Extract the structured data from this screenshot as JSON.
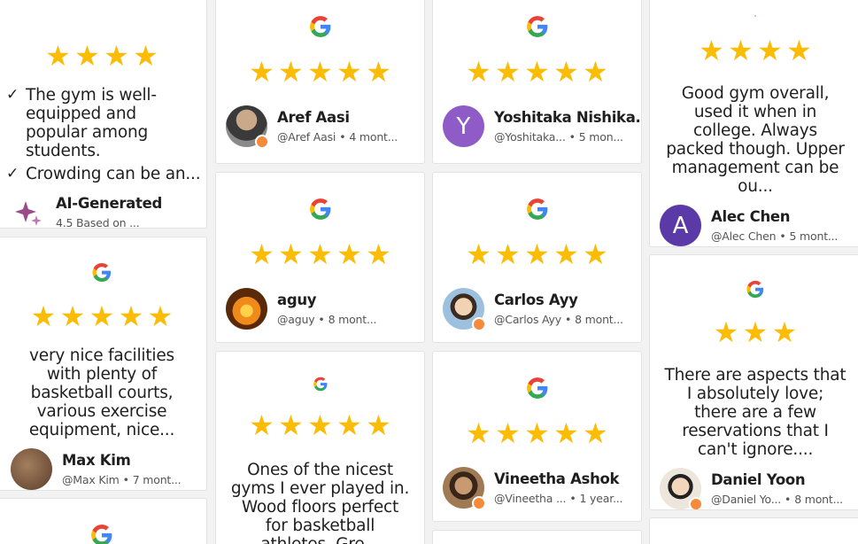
{
  "ai_card": {
    "stars": 4,
    "points": [
      "The gym is well-equipped and popular among students.",
      "Crowding can be an..."
    ],
    "title": "AI-Generated",
    "subtitle": "4.5 Based on ..."
  },
  "reviews": [
    {
      "id": "aref",
      "stars": 5,
      "text": "",
      "name": "Aref Aasi",
      "handle": "@Aref Aasi",
      "time": "4 mont...",
      "avatar_letter": "",
      "avatar_color": "#6b6b6b"
    },
    {
      "id": "yoshitaka",
      "stars": 5,
      "text": "",
      "name": "Yoshitaka Nishika...",
      "handle": "@Yoshitaka...",
      "time": "5 mon...",
      "avatar_letter": "Y",
      "avatar_color": "#8e5bc7"
    },
    {
      "id": "alec",
      "stars": 4,
      "text": "Good gym overall, used it when in college. Always packed though. Upper management can be ou...",
      "name": "Alec Chen",
      "handle": "@Alec Chen",
      "time": "5 mont...",
      "avatar_letter": "A",
      "avatar_color": "#5b3aa8"
    },
    {
      "id": "maxkim",
      "stars": 5,
      "text": "very nice facilities with plenty of basketball courts, various exercise equipment, nice...",
      "name": "Max Kim",
      "handle": "@Max Kim",
      "time": "7 mont...",
      "avatar_letter": "",
      "avatar_color": "#6a4a35"
    },
    {
      "id": "aguy",
      "stars": 5,
      "text": "",
      "name": "aguy",
      "handle": "@aguy",
      "time": "8 mont...",
      "avatar_letter": "",
      "avatar_color": "#e07a1a"
    },
    {
      "id": "carlos",
      "stars": 5,
      "text": "",
      "name": "Carlos Ayy",
      "handle": "@Carlos Ayy",
      "time": "8 mont...",
      "avatar_letter": "",
      "avatar_color": "#7fa6c9"
    },
    {
      "id": "daniel",
      "stars": 3,
      "text": "There are aspects that I absolutely love; there are a few reservations that I can't ignore....",
      "name": "Daniel Yoon",
      "handle": "@Daniel Yo...",
      "time": "8 mont...",
      "avatar_letter": "",
      "avatar_color": "#d9d2c5"
    },
    {
      "id": "nicest",
      "stars": 5,
      "text": "Ones of the nicest gyms I ever played in. Wood floors perfect for basketball athletes. Gre...",
      "name": "",
      "handle": "",
      "time": "",
      "avatar_letter": "",
      "avatar_color": ""
    },
    {
      "id": "vineetha",
      "stars": 5,
      "text": "",
      "name": "Vineetha Ashok",
      "handle": "@Vineetha ...",
      "time": "1 year...",
      "avatar_letter": "",
      "avatar_color": "#a07a55"
    }
  ],
  "colors": {
    "star": "#fbbc05",
    "badge": "#f58b3a"
  }
}
